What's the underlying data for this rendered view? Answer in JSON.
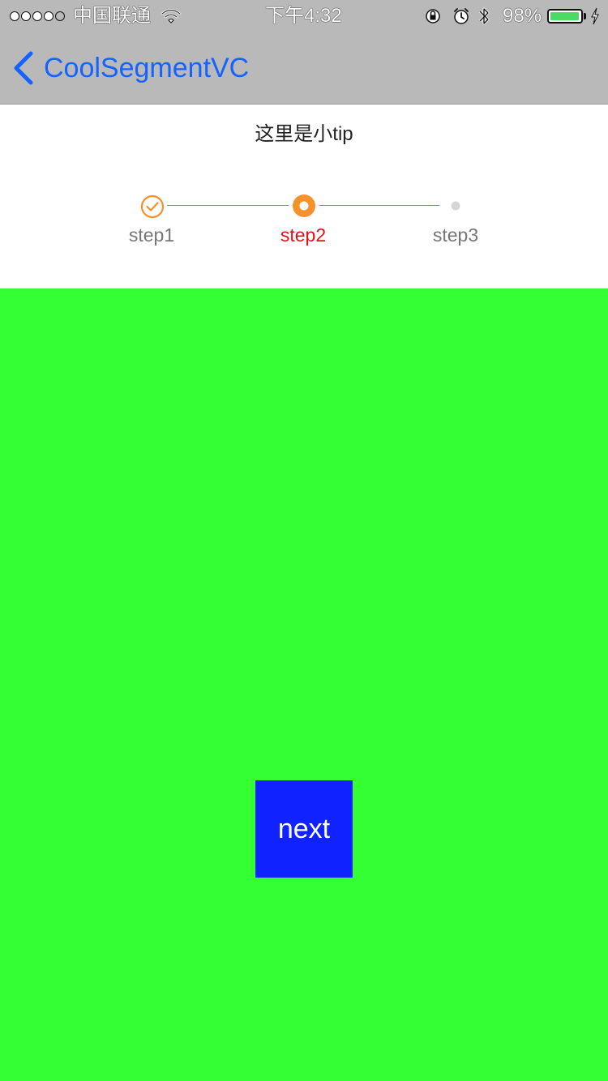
{
  "status_bar": {
    "carrier": "中国联通",
    "time": "下午4:32",
    "battery_percent": "98%",
    "battery_level": 0.98,
    "signal_bars_filled": 4,
    "signal_bars_total": 5
  },
  "nav": {
    "back_label": "CoolSegmentVC"
  },
  "header": {
    "tip": "这里是小tip"
  },
  "stepper": {
    "current_step_index": 1,
    "steps": [
      {
        "label": "step1",
        "state": "done"
      },
      {
        "label": "step2",
        "state": "current"
      },
      {
        "label": "step3",
        "state": "pending"
      }
    ]
  },
  "content": {
    "next_label": "next"
  },
  "colors": {
    "nav_background": "#b9b9b9",
    "back_tint": "#1463ff",
    "content_background": "#33ff33",
    "next_button_background": "#0f22ff",
    "step_active_label": "#e8101a",
    "step_icon_accent": "#f7902d",
    "step_line": "#34c82e",
    "step_inactive_label": "#777777",
    "step_pending_dot": "#d6d6d6"
  }
}
